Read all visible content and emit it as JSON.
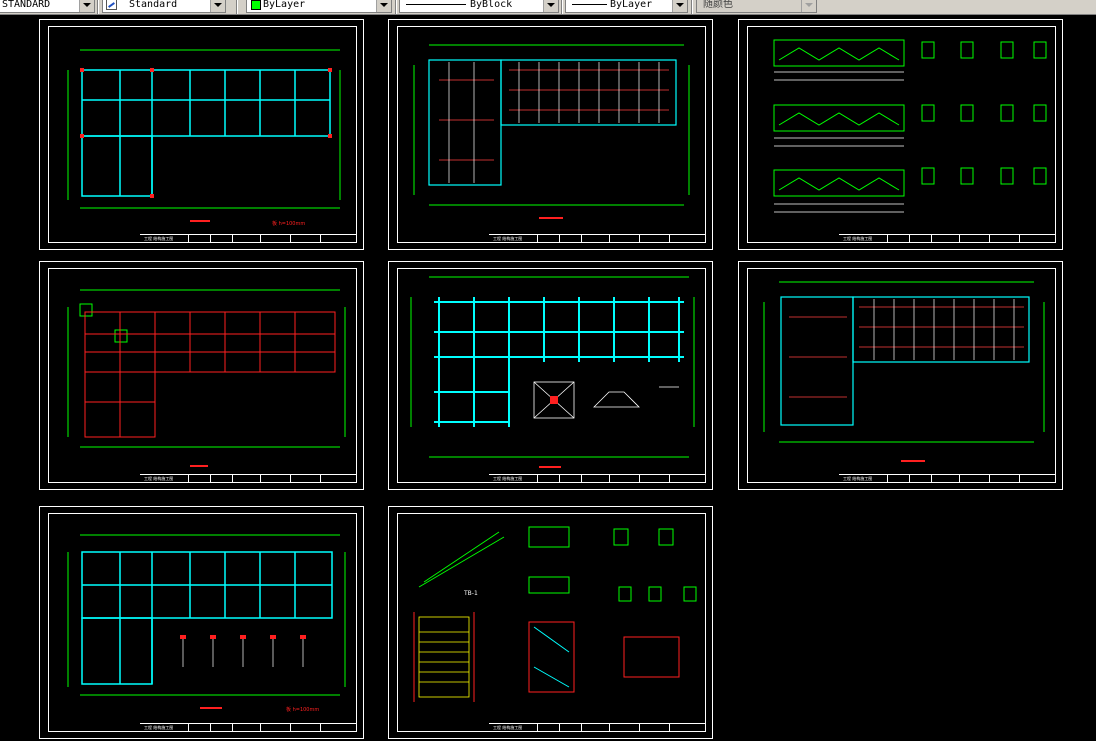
{
  "toolbar": {
    "text_style": "STANDARD",
    "dim_style": "Standard",
    "color": "ByLayer",
    "color_swatch": "#00ff00",
    "linetype": "ByBlock",
    "lineweight": "ByLayer",
    "plot_style": "随颜色"
  },
  "colors": {
    "background": "#000000",
    "frame": "#ffffff",
    "axis": "#00ff00",
    "beam": "#00ffff",
    "column": "#ff0000",
    "rebar": "#00ff00",
    "accent": "#ff2020",
    "stair": "#ffff00"
  },
  "sheets": [
    {
      "name": "sheet-floor-plan-1",
      "title_label": "工程 结构施工图",
      "note": "板 h=100mm"
    },
    {
      "name": "sheet-beam-reinforcement-plan",
      "title_label": "工程 结构施工图",
      "note": ""
    },
    {
      "name": "sheet-beam-section-details",
      "title_label": "工程 结构施工图",
      "note": ""
    },
    {
      "name": "sheet-column-layout-plan",
      "title_label": "工程 结构施工图",
      "note": ""
    },
    {
      "name": "sheet-foundation-plan",
      "title_label": "工程 结构施工图",
      "note": ""
    },
    {
      "name": "sheet-beam-reinforcement-plan-2",
      "title_label": "工程 结构施工图",
      "note": ""
    },
    {
      "name": "sheet-floor-plan-2",
      "title_label": "工程 结构施工图",
      "note": "板 h=100mm"
    },
    {
      "name": "sheet-stair-details",
      "title_label": "工程 结构施工图",
      "note": "TB-1"
    }
  ]
}
